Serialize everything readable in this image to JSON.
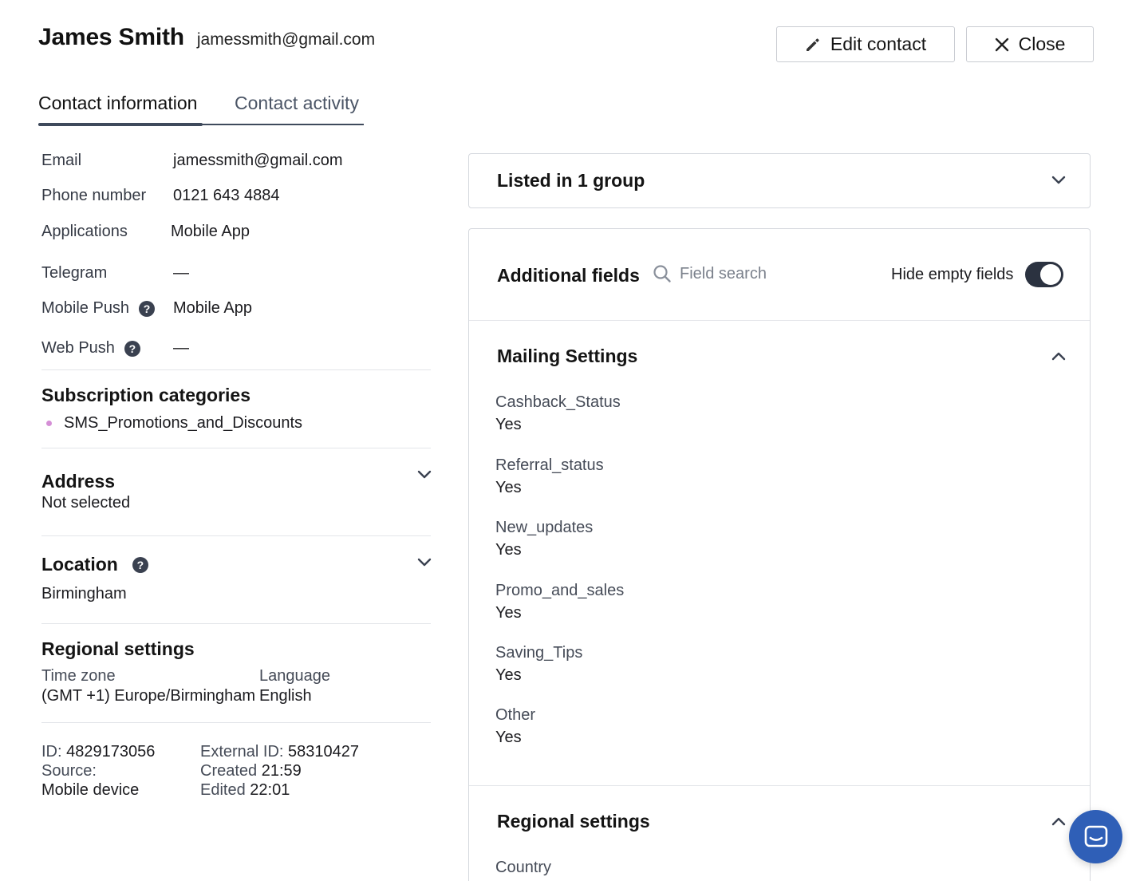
{
  "header": {
    "name": "James Smith",
    "email": "jamessmith@gmail.com",
    "edit_label": "Edit contact",
    "close_label": "Close"
  },
  "tabs": [
    {
      "label": "Contact information",
      "active": true
    },
    {
      "label": "Contact activity",
      "active": false
    }
  ],
  "contact": {
    "rows": [
      {
        "label": "Email",
        "value": "jamessmith@gmail.com"
      },
      {
        "label": "Phone number",
        "value": "0121 643 4884"
      },
      {
        "label": "Applications",
        "value": "Mobile App"
      },
      {
        "label": "Telegram",
        "value": "—"
      },
      {
        "label": "Mobile Push",
        "value": "Mobile App"
      },
      {
        "label": "Web Push",
        "value": "—"
      }
    ]
  },
  "subscription": {
    "title": "Subscription categories",
    "items": [
      "SMS_Promotions_and_Discounts"
    ],
    "bullet_color": "#d58fd6"
  },
  "address": {
    "title": "Address",
    "value": "Not selected"
  },
  "location": {
    "title": "Location",
    "value": "Birmingham"
  },
  "regional": {
    "title": "Regional settings",
    "timezone_label": "Time zone",
    "timezone_value": "(GMT +1) Europe/Birmingham",
    "language_label": "Language",
    "language_value": "English"
  },
  "meta": {
    "id_label": "ID:",
    "id_value": "4829173056",
    "source_label": "Source:",
    "source_value": "Mobile device",
    "external_label": "External ID:",
    "external_value": "58310427",
    "created_label": "Created",
    "created_value": "21:59",
    "edited_label": "Edited",
    "edited_value": "22:01"
  },
  "groups": {
    "title": "Listed in 1 group"
  },
  "additional": {
    "title": "Additional fields",
    "search_placeholder": "Field search",
    "hide_empty_label": "Hide empty fields",
    "hide_empty_on": true,
    "mailing": {
      "title": "Mailing Settings",
      "fields": [
        {
          "label": "Cashback_Status",
          "value": "Yes"
        },
        {
          "label": "Referral_status",
          "value": "Yes"
        },
        {
          "label": "New_updates",
          "value": "Yes"
        },
        {
          "label": "Promo_and_sales",
          "value": "Yes"
        },
        {
          "label": "Saving_Tips",
          "value": "Yes"
        },
        {
          "label": "Other",
          "value": "Yes"
        }
      ]
    },
    "regional": {
      "title": "Regional settings",
      "fields": [
        {
          "label": "Country"
        }
      ]
    }
  },
  "colors": {
    "accent": "#3f4a5c",
    "toggle_on": "#2b3240",
    "chat_bubble": "#2f5fb7"
  }
}
